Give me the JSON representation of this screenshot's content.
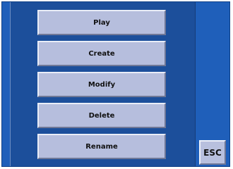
{
  "menu": {
    "play_label": "Play",
    "create_label": "Create",
    "modify_label": "Modify",
    "delete_label": "Delete",
    "rename_label": "Rename"
  },
  "esc_label": "ESC",
  "colors": {
    "background": "#1f5fba",
    "panel": "#1c4f9b",
    "button_face": "#b6bedd",
    "button_highlight": "#e9edf7",
    "button_shadow": "#6f7897",
    "text": "#111111"
  }
}
